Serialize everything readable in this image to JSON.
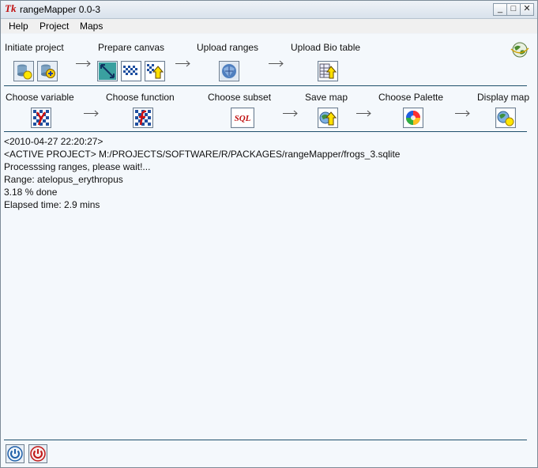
{
  "window": {
    "title": "rangeMapper 0.0-3",
    "logo": "Tk",
    "controls": {
      "minimize": "_",
      "maximize": "□",
      "close": "✕"
    }
  },
  "menu": [
    "Help",
    "Project",
    "Maps"
  ],
  "steps_row1": {
    "initiate": "Initiate project",
    "prepare": "Prepare canvas",
    "upload_ranges": "Upload ranges",
    "upload_bio": "Upload Bio table"
  },
  "steps_row2": {
    "choose_variable": "Choose variable",
    "choose_function": "Choose function",
    "choose_subset": "Choose subset",
    "save_map": "Save map",
    "choose_palette": "Choose Palette",
    "display_map": "Display map"
  },
  "icons": {
    "subset_sql": "SQL"
  },
  "log": [
    "<2010-04-27 22:20:27>",
    "<ACTIVE PROJECT> M:/PROJECTS/SOFTWARE/R/PACKAGES/rangeMapper/frogs_3.sqlite",
    "Processsing ranges, please wait!...",
    "Range:  atelopus_erythropus",
    "3.18 % done",
    "Elapsed time: 2.9 mins"
  ],
  "colors": {
    "accent": "#1e4f6b",
    "power_blue": "#1f5fa8",
    "power_red": "#c01818"
  }
}
